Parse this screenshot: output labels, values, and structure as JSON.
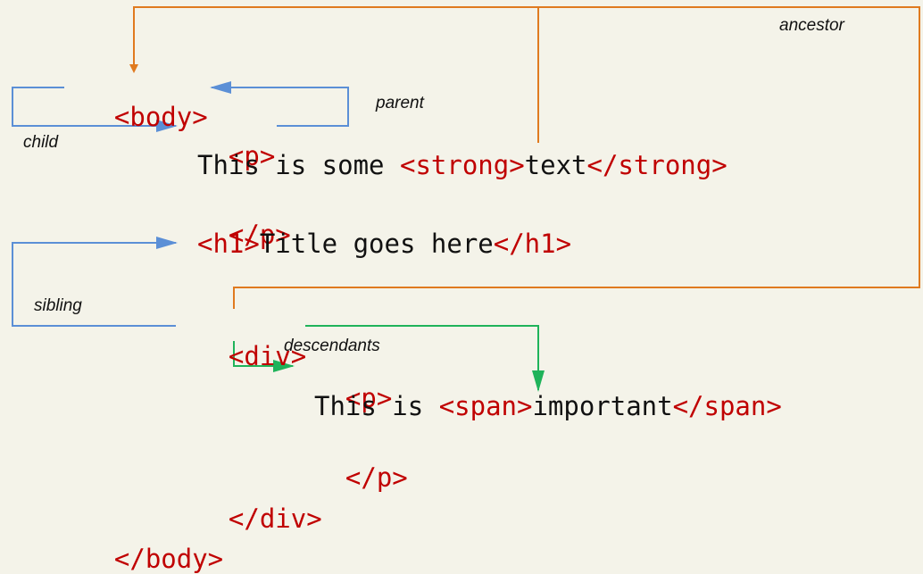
{
  "code_lines": {
    "body_open": "<body>",
    "p_open": "<p>",
    "line_text_prefix": "This is some ",
    "strong_open": "<strong>",
    "strong_text": "text",
    "strong_close": "</strong>",
    "p_close": "</p>",
    "h1_open": "<h1>",
    "h1_text": "Title goes here",
    "h1_close": "</h1>",
    "div_open": "<div>",
    "inner_p_open": "<p>",
    "inner_text_prefix": "This is ",
    "span_open": "<span>",
    "span_text": "important",
    "span_close": "</span>",
    "inner_p_close": "</p>",
    "div_close": "</div>",
    "body_close": "</body>"
  },
  "labels": {
    "ancestor": "ancestor",
    "parent": "parent",
    "child": "child",
    "sibling": "sibling",
    "descendants": "descendants"
  },
  "colors": {
    "background": "#f4f3e9",
    "tag": "#c00000",
    "text": "#111111",
    "ancestor_line": "#e07a1f",
    "parent_child_line": "#5b8fd6",
    "descendants_line": "#1fb35a"
  }
}
